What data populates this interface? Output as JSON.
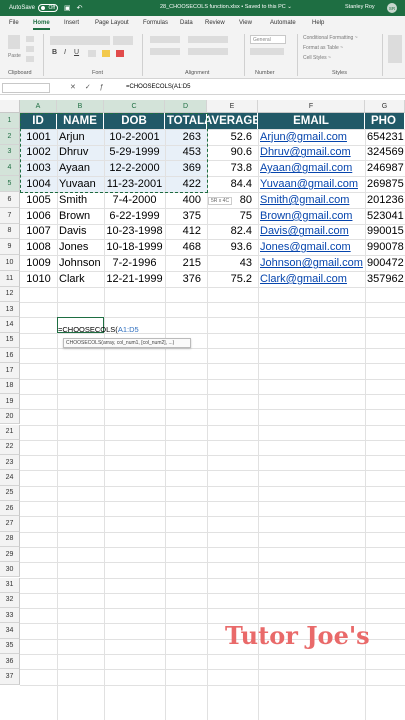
{
  "titlebar": {
    "autosave_label": "AutoSave",
    "autosave_state": "Off",
    "file_name": "28_CHOOSECOLS function.xlsx  •  Saved to this PC  ⌄",
    "user_name": "Stanley Roy",
    "user_initials": "SR"
  },
  "menu": {
    "items": [
      "File",
      "Home",
      "Insert",
      "Page Layout",
      "Formulas",
      "Data",
      "Review",
      "View",
      "Automate",
      "Help"
    ],
    "active": "Home"
  },
  "ribbon": {
    "groups": [
      "Clipboard",
      "Font",
      "Alignment",
      "Number",
      "Styles"
    ],
    "paste_label": "Paste",
    "number_format": "General",
    "styles": [
      "Conditional Formatting ~",
      "Format as Table ~",
      "Cell Styles ~"
    ]
  },
  "formula_bar": {
    "name_box": "",
    "formula": "=CHOOSECOLS(A1:D5"
  },
  "columns": [
    "A",
    "B",
    "C",
    "D",
    "E",
    "F",
    "G"
  ],
  "rows": [
    "1",
    "2",
    "3",
    "4",
    "5",
    "6",
    "7",
    "8",
    "9",
    "10",
    "11",
    "12",
    "13",
    "14",
    "15",
    "16",
    "17",
    "18",
    "19",
    "20",
    "21",
    "22",
    "23",
    "24",
    "25",
    "26",
    "27",
    "28",
    "29",
    "30",
    "31",
    "32",
    "33",
    "34",
    "35",
    "36",
    "37"
  ],
  "table": {
    "headers": [
      "ID",
      "NAME",
      "DOB",
      "TOTAL",
      "AVERAGE",
      "EMAIL",
      "PHO"
    ],
    "rows": [
      [
        "1001",
        "Arjun",
        "10-2-2001",
        "263",
        "52.6",
        "Arjun@gmail.com",
        "654231"
      ],
      [
        "1002",
        "Dhruv",
        "5-29-1999",
        "453",
        "90.6",
        "Dhruv@gmail.com",
        "324569"
      ],
      [
        "1003",
        "Ayaan",
        "12-2-2000",
        "369",
        "73.8",
        "Ayaan@gmail.com",
        "246987"
      ],
      [
        "1004",
        "Yuvaan",
        "11-23-2001",
        "422",
        "84.4",
        "Yuvaan@gmail.com",
        "269875"
      ],
      [
        "1005",
        "Smith",
        "7-4-2000",
        "400",
        "80",
        "Smith@gmail.com",
        "201236"
      ],
      [
        "1006",
        "Brown",
        "6-22-1999",
        "375",
        "75",
        "Brown@gmail.com",
        "523041"
      ],
      [
        "1007",
        "Davis",
        "10-23-1998",
        "412",
        "82.4",
        "Davis@gmail.com",
        "990015"
      ],
      [
        "1008",
        "Jones",
        "10-18-1999",
        "468",
        "93.6",
        "Jones@gmail.com",
        "990078"
      ],
      [
        "1009",
        "Johnson",
        "7-2-1996",
        "215",
        "43",
        "Johnson@gmail.com",
        "900472"
      ],
      [
        "1010",
        "Clark",
        "12-21-1999",
        "376",
        "75.2",
        "Clark@gmail.com",
        "357962"
      ]
    ]
  },
  "editing": {
    "prefix": "=CHOOSECOLS(",
    "ref": "A1:D5",
    "tooltip": "CHOOSECOLS(array, col_num1, [col_num2], ...)",
    "size_tip": "5R x 4C"
  },
  "watermark": "Tutor Joe's",
  "colors": {
    "excel_green": "#1e6e42",
    "header_fill": "#215967",
    "link": "#0645ad",
    "watermark": "#e96a6a"
  }
}
